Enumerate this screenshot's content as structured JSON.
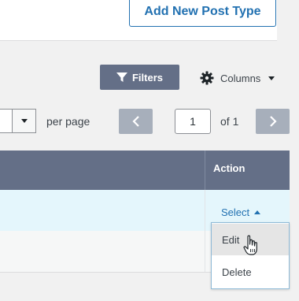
{
  "header": {
    "add_button_label": "Add New Post Type"
  },
  "toolbar": {
    "filters_label": "Filters",
    "filter_icon": "filter-funnel-icon",
    "columns_label": "Columns",
    "columns_icon": "gear-icon"
  },
  "pagination": {
    "per_page_label": "per page",
    "current_page": "1",
    "of_label": "of 1"
  },
  "table": {
    "headers": {
      "action": "Action"
    },
    "row_action": {
      "select_label": "Select"
    }
  },
  "dropdown": {
    "items": [
      "Edit",
      "Delete"
    ]
  },
  "colors": {
    "accent": "#2271b1",
    "header_bg": "#646f87",
    "highlight_row": "#e4f6fc",
    "disabled_button": "#a7afbb"
  }
}
